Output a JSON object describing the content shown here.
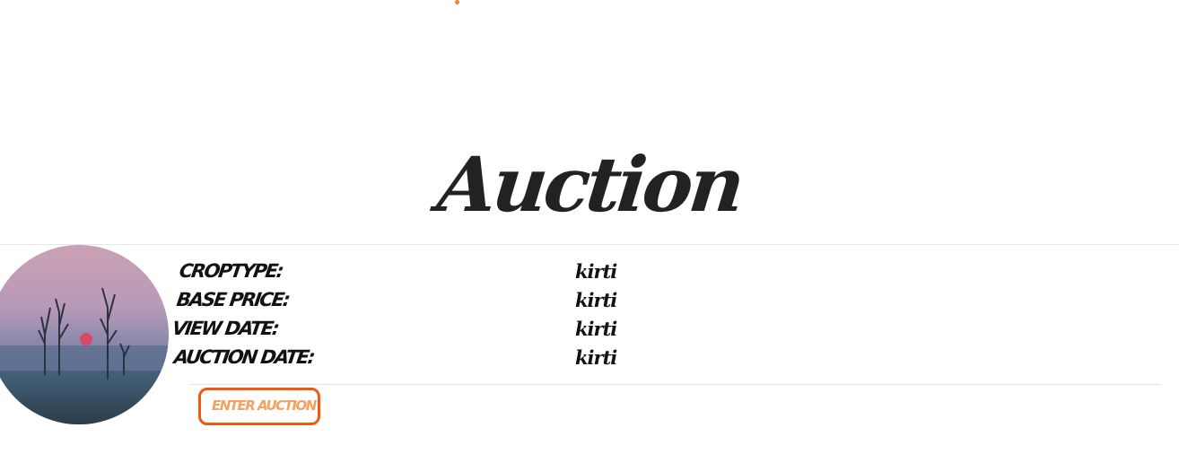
{
  "header": {
    "title": "Auction"
  },
  "listing": {
    "image_icon": "sunset-landscape-image",
    "fields": [
      {
        "label": "CROPTYPE:",
        "value": "kirti"
      },
      {
        "label": "BASE PRICE:",
        "value": "kirti"
      },
      {
        "label": "VIEW DATE:",
        "value": "kirti"
      },
      {
        "label": "AUCTION DATE:",
        "value": "kirti"
      }
    ],
    "enter_button_label": "ENTER AUCTION"
  },
  "colors": {
    "accent": "#f05a0f",
    "button_text": "#f2a25e",
    "text": "#111111"
  }
}
